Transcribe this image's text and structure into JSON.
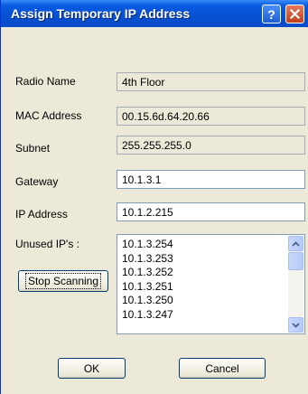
{
  "window": {
    "title": "Assign Temporary IP Address",
    "help_glyph": "?"
  },
  "fields": {
    "radio_name": {
      "label": "Radio Name",
      "value": "4th Floor"
    },
    "mac_address": {
      "label": "MAC Address",
      "value": "00.15.6d.64.20.66"
    },
    "subnet": {
      "label": "Subnet",
      "value": "255.255.255.0"
    },
    "gateway": {
      "label": "Gateway",
      "value": "10.1.3.1"
    },
    "ip_address": {
      "label": "IP Address",
      "value": "10.1.2.215"
    }
  },
  "unused_ips": {
    "label": "Unused IP's :",
    "items": [
      "10.1.3.254",
      "10.1.3.253",
      "10.1.3.252",
      "10.1.3.251",
      "10.1.3.250",
      "10.1.3.247"
    ]
  },
  "buttons": {
    "stop_scanning": "Stop Scanning",
    "ok": "OK",
    "cancel": "Cancel"
  },
  "colors": {
    "titlebar": "#0a5ce0",
    "dialog_bg": "#ece9d8",
    "close_button": "#c2401c"
  }
}
